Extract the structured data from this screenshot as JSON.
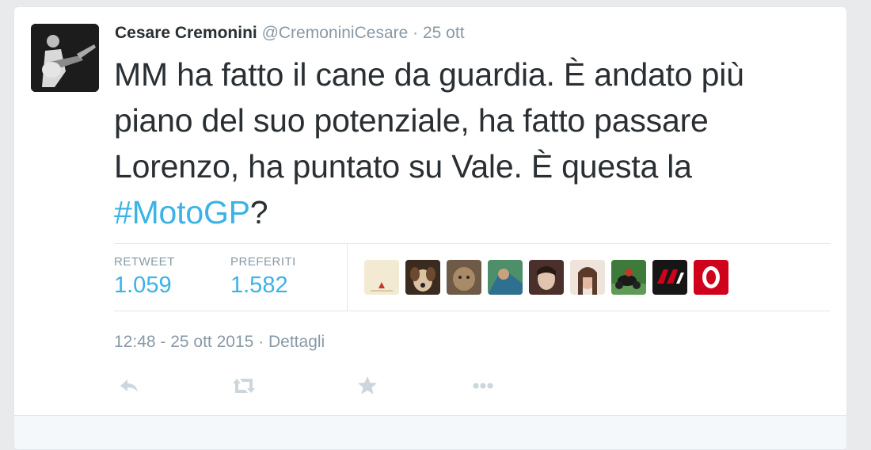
{
  "tweet": {
    "author": {
      "fullname": "Cesare Cremonini",
      "username": "@CremoniniCesare",
      "separator": "·",
      "time_ago": "25 ott"
    },
    "text_before_hashtag": "MM ha fatto il cane da guardia. È andato più piano del suo potenziale, ha fatto passare Lorenzo, ha puntato su Vale. È questa la ",
    "hashtag": "#MotoGP",
    "text_after_hashtag": "?",
    "stats": {
      "retweet_label": "RETWEET",
      "retweet_count": "1.059",
      "favorites_label": "PREFERITI",
      "favorites_count": "1.582"
    },
    "favorited_by_avatars": [
      "avatar-1",
      "avatar-2",
      "avatar-3",
      "avatar-4",
      "avatar-5",
      "avatar-6",
      "avatar-7",
      "avatar-8",
      "avatar-9"
    ],
    "timestamp": "12:48 - 25 ott 2015",
    "timestamp_separator": "·",
    "details_link": "Dettagli",
    "actions": [
      "reply-icon",
      "retweet-icon",
      "favorite-icon",
      "more-icon"
    ]
  },
  "colors": {
    "link": "#3ab3e6",
    "muted": "#8899a6",
    "text": "#292f33",
    "border": "#e1e8ed"
  }
}
